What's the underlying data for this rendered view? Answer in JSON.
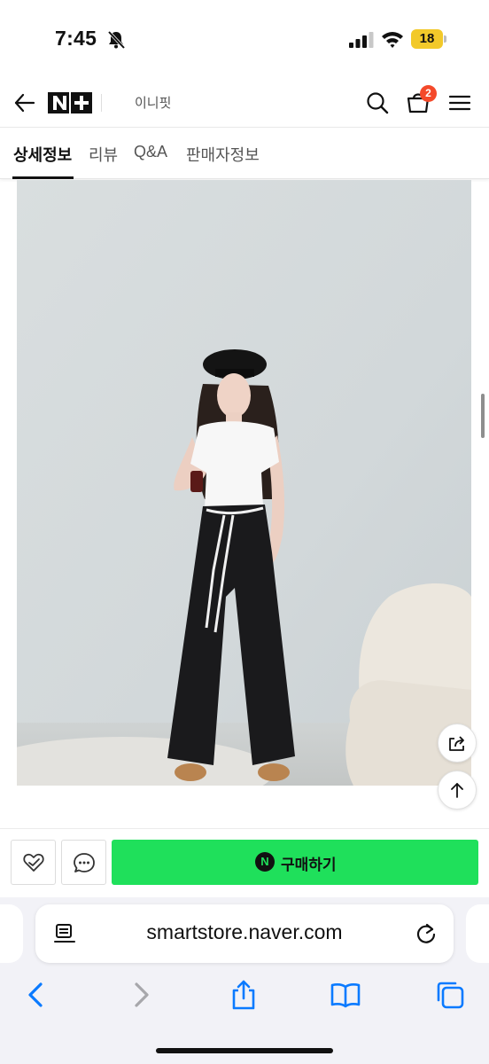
{
  "status_bar": {
    "time": "7:45",
    "battery_level": "18",
    "icons": [
      "bell-slash-icon",
      "signal-icon",
      "wifi-icon",
      "battery-icon"
    ]
  },
  "header": {
    "logo_text": "N+",
    "store_name": "이니핏",
    "cart_count": "2",
    "icons": [
      "back-arrow-icon",
      "search-icon",
      "cart-icon",
      "menu-icon"
    ]
  },
  "tabs": [
    {
      "label": "상세정보",
      "active": true
    },
    {
      "label": "리뷰",
      "active": false
    },
    {
      "label": "Q&A",
      "active": false
    },
    {
      "label": "판매자정보",
      "active": false
    }
  ],
  "floating_buttons": {
    "share_icon": "share-icon",
    "top_icon": "arrow-up-icon"
  },
  "purchase_bar": {
    "buy_badge": "N",
    "buy_label": "구매하기",
    "buy_color": "#1fe05b",
    "icons": [
      "heart-check-icon",
      "chat-bubble-icon"
    ]
  },
  "safari": {
    "url": "smartstore.naver.com",
    "icons": [
      "reader-icon",
      "reload-icon",
      "back-icon",
      "forward-icon",
      "share-icon",
      "bookmarks-icon",
      "tabs-icon"
    ]
  },
  "colors": {
    "accent_blue": "#0a7aff",
    "badge_red": "#f4492a",
    "battery_yellow": "#f2c92a"
  }
}
